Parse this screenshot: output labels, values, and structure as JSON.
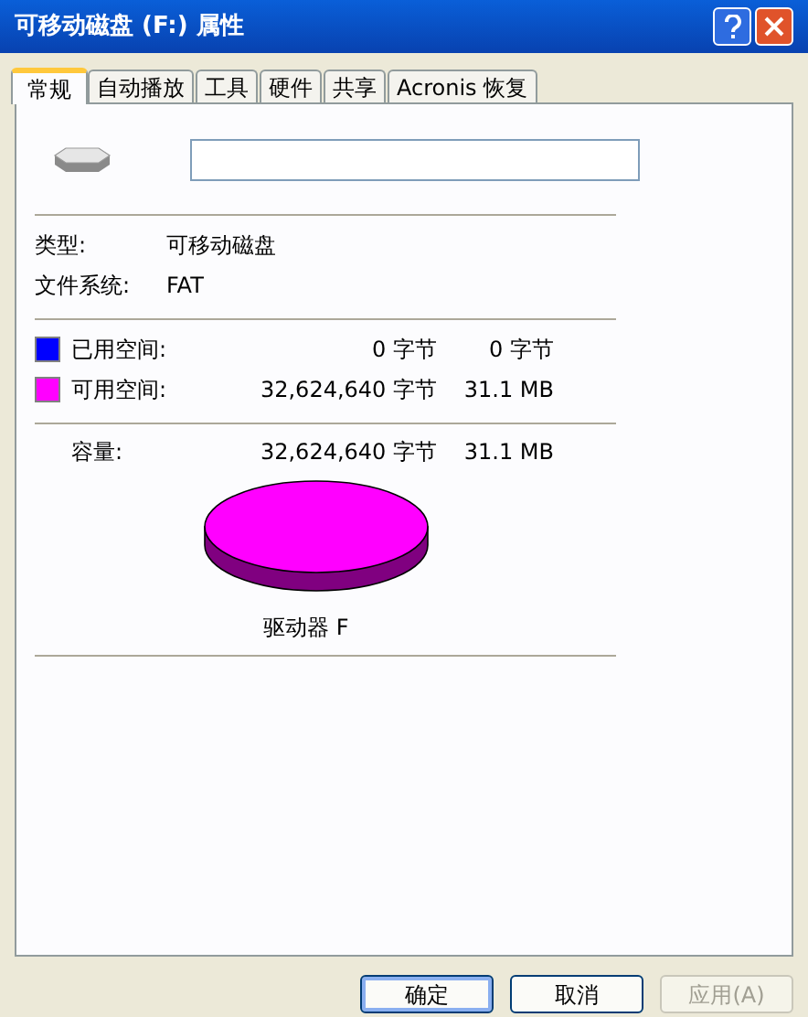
{
  "window": {
    "title": "可移动磁盘 (F:) 属性"
  },
  "tabs": [
    {
      "label": "常规",
      "selected": true
    },
    {
      "label": "自动播放",
      "selected": false
    },
    {
      "label": "工具",
      "selected": false
    },
    {
      "label": "硬件",
      "selected": false
    },
    {
      "label": "共享",
      "selected": false
    },
    {
      "label": "Acronis 恢复",
      "selected": false
    }
  ],
  "info": [
    {
      "label": "类型:",
      "value": "可移动磁盘"
    },
    {
      "label": "文件系统:",
      "value": "FAT"
    }
  ],
  "space": [
    {
      "label": "已用空间:",
      "bytes": "0 字节",
      "size": "0 字节",
      "color": "#0000ff"
    },
    {
      "label": "可用空间:",
      "bytes": "32,624,640 字节",
      "size": "31.1 MB",
      "color": "#ff00ff"
    }
  ],
  "capacity": {
    "label": "容量:",
    "bytes": "32,624,640 字节",
    "size": "31.1 MB"
  },
  "drive_label": "驱动器 F",
  "buttons": [
    {
      "label": "确定",
      "disabled": false,
      "default": true
    },
    {
      "label": "取消",
      "disabled": false,
      "default": false
    },
    {
      "label": "应用(A)",
      "disabled": true,
      "default": false
    }
  ]
}
